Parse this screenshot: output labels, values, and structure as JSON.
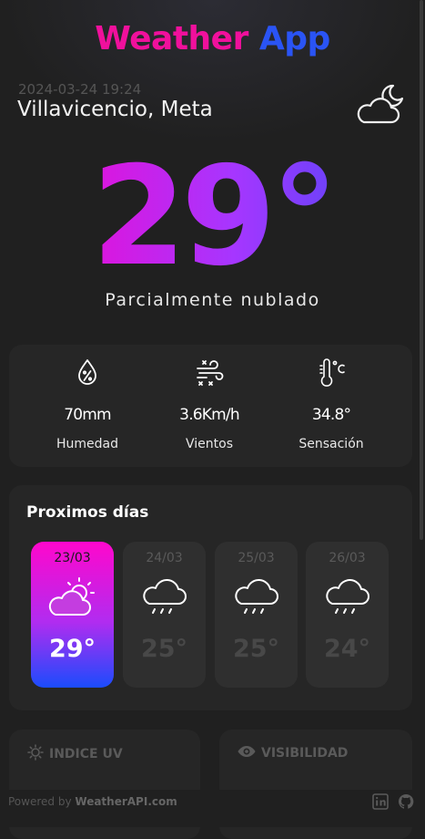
{
  "header": {
    "title_part1": "Weather",
    "title_part2": "App"
  },
  "location": {
    "datetime": "2024-03-24 19:24",
    "city": "Villavicencio, Meta",
    "icon": "partly-cloudy-night-icon"
  },
  "current": {
    "temperature": "29°",
    "condition": "Parcialmente nublado"
  },
  "stats": [
    {
      "icon": "humidity-icon",
      "value": "70mm",
      "label": "Humedad"
    },
    {
      "icon": "wind-icon",
      "value": "3.6Km/h",
      "label": "Vientos"
    },
    {
      "icon": "thermometer-icon",
      "value": "34.8°",
      "label": "Sensación"
    }
  ],
  "forecast": {
    "title": "Proximos días",
    "days": [
      {
        "date": "23/03",
        "temp": "29°",
        "icon": "partly-cloudy-day-icon",
        "selected": true
      },
      {
        "date": "24/03",
        "temp": "25°",
        "icon": "rain-cloud-icon",
        "selected": false
      },
      {
        "date": "25/03",
        "temp": "25°",
        "icon": "rain-cloud-icon",
        "selected": false
      },
      {
        "date": "26/03",
        "temp": "24°",
        "icon": "rain-cloud-icon",
        "selected": false
      }
    ]
  },
  "panels": {
    "uv_label": "INDICE UV",
    "visibility_label": "VISIBILIDAD"
  },
  "footer": {
    "powered_prefix": "Powered by",
    "powered_brand": "WeatherAPI.com"
  },
  "colors": {
    "accent_pink": "#ff00c8",
    "accent_blue": "#2a54f5",
    "background": "#202020",
    "card": "#262626"
  }
}
